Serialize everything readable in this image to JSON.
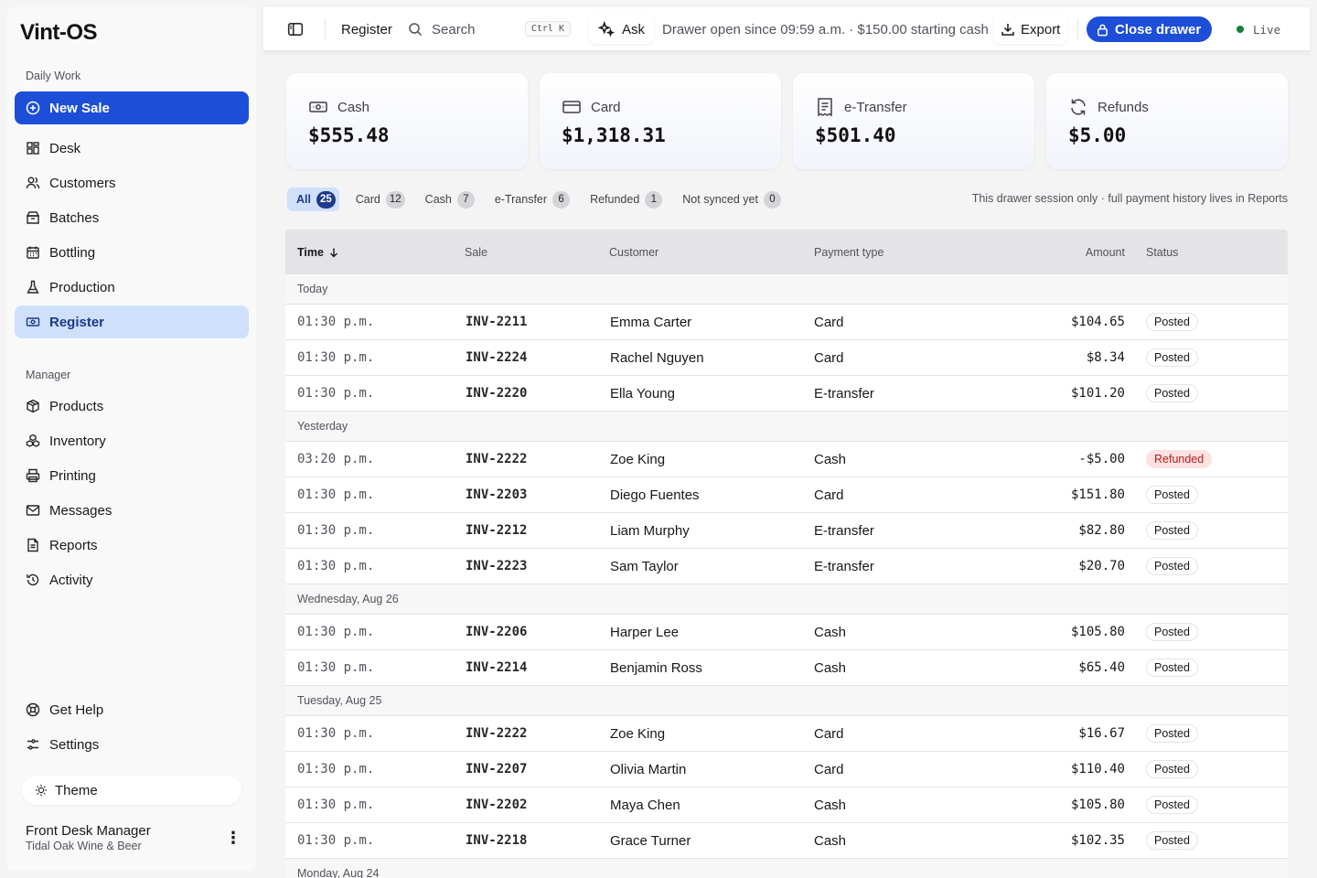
{
  "app": {
    "logo": "Vint-OS"
  },
  "sidebar": {
    "section_daily": "Daily Work",
    "new_sale": "New Sale",
    "daily_items": [
      {
        "label": "Desk",
        "icon": "grid-icon"
      },
      {
        "label": "Customers",
        "icon": "users-icon"
      },
      {
        "label": "Batches",
        "icon": "boxes-icon"
      },
      {
        "label": "Bottling",
        "icon": "calendar-icon"
      },
      {
        "label": "Production",
        "icon": "flask-icon"
      },
      {
        "label": "Register",
        "icon": "cash-icon"
      }
    ],
    "section_manager": "Manager",
    "manager_items": [
      {
        "label": "Products",
        "icon": "package-icon"
      },
      {
        "label": "Inventory",
        "icon": "cubes-icon"
      },
      {
        "label": "Printing",
        "icon": "printer-icon"
      },
      {
        "label": "Messages",
        "icon": "mail-icon"
      },
      {
        "label": "Reports",
        "icon": "file-icon"
      },
      {
        "label": "Activity",
        "icon": "history-icon"
      }
    ],
    "help": "Get Help",
    "settings": "Settings",
    "theme": "Theme",
    "user_name": "Front Desk Manager",
    "user_org": "Tidal Oak Wine & Beer",
    "menu_glyph": "⋮"
  },
  "topbar": {
    "breadcrumb": "Register",
    "search_placeholder": "Search",
    "search_shortcut": "Ctrl K",
    "ask": "Ask",
    "drawer_info": "Drawer open since 09:59 a.m. · $150.00 starting cash",
    "export": "Export",
    "close_drawer": "Close drawer",
    "live": "Live"
  },
  "summary": [
    {
      "label": "Cash",
      "value": "$555.48",
      "icon": "cash-icon"
    },
    {
      "label": "Card",
      "value": "$1,318.31",
      "icon": "credit-card-icon"
    },
    {
      "label": "e-Transfer",
      "value": "$501.40",
      "icon": "receipt-icon"
    },
    {
      "label": "Refunds",
      "value": "$5.00",
      "icon": "refresh-icon"
    }
  ],
  "filters": [
    {
      "label": "All",
      "count": "25"
    },
    {
      "label": "Card",
      "count": "12"
    },
    {
      "label": "Cash",
      "count": "7"
    },
    {
      "label": "e-Transfer",
      "count": "6"
    },
    {
      "label": "Refunded",
      "count": "1"
    },
    {
      "label": "Not synced yet",
      "count": "0"
    }
  ],
  "filter_note": "This drawer session only · full payment history lives in Reports",
  "table": {
    "headers": {
      "time": "Time",
      "sale": "Sale",
      "customer": "Customer",
      "payment": "Payment type",
      "amount": "Amount",
      "status": "Status"
    },
    "groups": [
      {
        "label": "Today",
        "rows": [
          {
            "time": "01:30 p.m.",
            "sale": "INV-2211",
            "customer": "Emma Carter",
            "payment": "Card",
            "amount": "$104.65",
            "status": "Posted"
          },
          {
            "time": "01:30 p.m.",
            "sale": "INV-2224",
            "customer": "Rachel Nguyen",
            "payment": "Card",
            "amount": "$8.34",
            "status": "Posted"
          },
          {
            "time": "01:30 p.m.",
            "sale": "INV-2220",
            "customer": "Ella Young",
            "payment": "E-transfer",
            "amount": "$101.20",
            "status": "Posted"
          }
        ]
      },
      {
        "label": "Yesterday",
        "rows": [
          {
            "time": "03:20 p.m.",
            "sale": "INV-2222",
            "customer": "Zoe King",
            "payment": "Cash",
            "amount": "-$5.00",
            "status": "Refunded"
          },
          {
            "time": "01:30 p.m.",
            "sale": "INV-2203",
            "customer": "Diego Fuentes",
            "payment": "Card",
            "amount": "$151.80",
            "status": "Posted"
          },
          {
            "time": "01:30 p.m.",
            "sale": "INV-2212",
            "customer": "Liam Murphy",
            "payment": "E-transfer",
            "amount": "$82.80",
            "status": "Posted"
          },
          {
            "time": "01:30 p.m.",
            "sale": "INV-2223",
            "customer": "Sam Taylor",
            "payment": "E-transfer",
            "amount": "$20.70",
            "status": "Posted"
          }
        ]
      },
      {
        "label": "Wednesday, Aug 26",
        "rows": [
          {
            "time": "01:30 p.m.",
            "sale": "INV-2206",
            "customer": "Harper Lee",
            "payment": "Cash",
            "amount": "$105.80",
            "status": "Posted"
          },
          {
            "time": "01:30 p.m.",
            "sale": "INV-2214",
            "customer": "Benjamin Ross",
            "payment": "Cash",
            "amount": "$65.40",
            "status": "Posted"
          }
        ]
      },
      {
        "label": "Tuesday, Aug 25",
        "rows": [
          {
            "time": "01:30 p.m.",
            "sale": "INV-2222",
            "customer": "Zoe King",
            "payment": "Card",
            "amount": "$16.67",
            "status": "Posted"
          },
          {
            "time": "01:30 p.m.",
            "sale": "INV-2207",
            "customer": "Olivia Martin",
            "payment": "Card",
            "amount": "$110.40",
            "status": "Posted"
          },
          {
            "time": "01:30 p.m.",
            "sale": "INV-2202",
            "customer": "Maya Chen",
            "payment": "Cash",
            "amount": "$105.80",
            "status": "Posted"
          },
          {
            "time": "01:30 p.m.",
            "sale": "INV-2218",
            "customer": "Grace Turner",
            "payment": "Cash",
            "amount": "$102.35",
            "status": "Posted"
          }
        ]
      },
      {
        "label": "Monday, Aug 24",
        "rows": []
      }
    ]
  },
  "colors": {
    "accent": "#1d4ed8",
    "active_bg": "#cfe0fb",
    "live": "#15803d",
    "refunded_bg": "#fde2e2",
    "refunded_text": "#b91c1c"
  }
}
